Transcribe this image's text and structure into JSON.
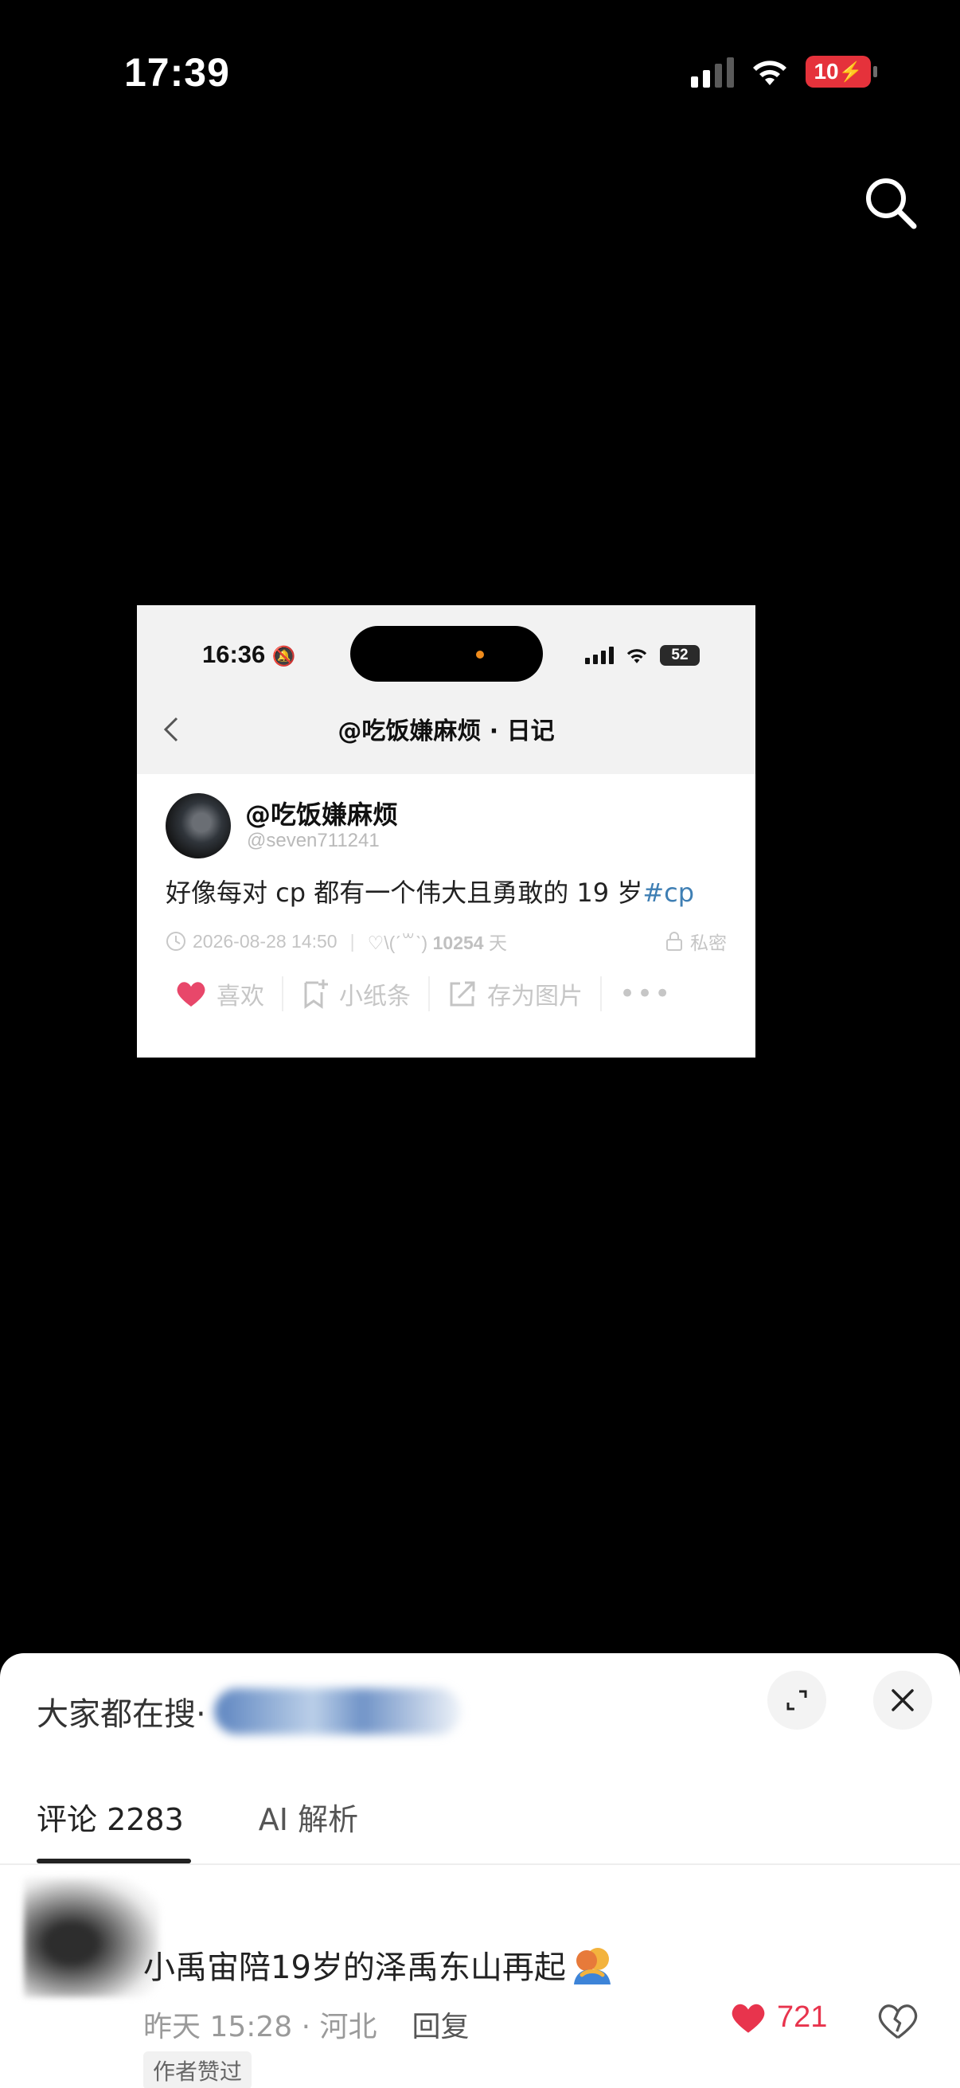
{
  "status_bar": {
    "time": "17:39",
    "battery": "10"
  },
  "inner_screenshot": {
    "status_time": "16:36",
    "battery": "52",
    "nav_title": "@吃饭嫌麻烦 · 日记",
    "post": {
      "author": "@吃饭嫌麻烦",
      "handle": "@seven711241",
      "text": "好像每对 cp 都有一个伟大且勇敢的 19 岁",
      "hashtag": "#cp",
      "date": "2026-08-28 14:50",
      "mood": "♡\\(ˊ꒳ˋ)",
      "days_count": "10254",
      "days_unit": "天",
      "privacy": "私密",
      "actions": {
        "like": "喜欢",
        "note": "小纸条",
        "save_image": "存为图片"
      }
    }
  },
  "sheet": {
    "hot_search_label": "大家都在搜·",
    "tabs": [
      {
        "label": "评论 2283"
      },
      {
        "label": "AI 解析"
      }
    ],
    "comment": {
      "text": "小禹宙陪19岁的泽禹东山再起",
      "time_location": "昨天 15:28 · 河北",
      "reply": "回复",
      "likes": "721",
      "badge": "作者赞过"
    }
  },
  "colors": {
    "accent_like": "#e8344d",
    "hashtag": "#3f7fb4",
    "battery_low": "#e5323b"
  }
}
